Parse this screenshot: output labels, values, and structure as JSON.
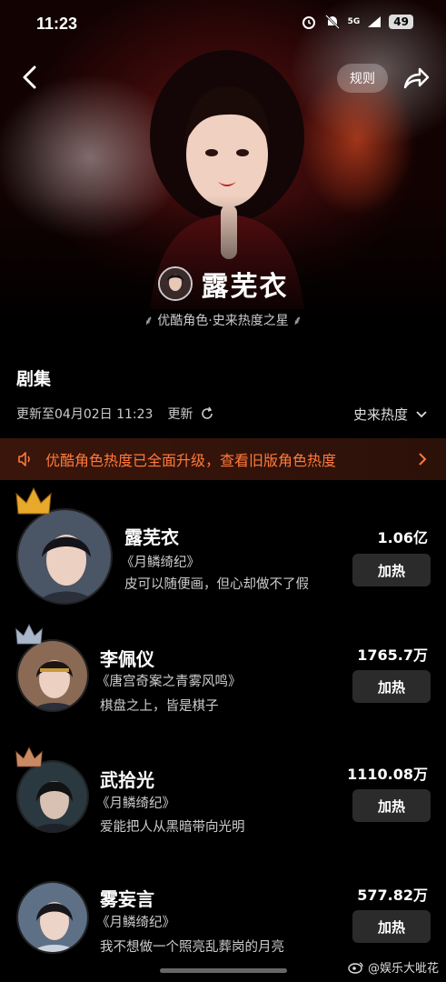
{
  "status": {
    "time": "11:23",
    "network": "5G",
    "battery": "49"
  },
  "header": {
    "rule_label": "规则"
  },
  "character": {
    "name": "露芜衣",
    "subtitle": "优酷角色·史来热度之星"
  },
  "section": {
    "title": "剧集",
    "updated": "更新至04月02日 11:23",
    "refresh_label": "更新",
    "sort_label": "史来热度"
  },
  "notice": {
    "text": "优酷角色热度已全面升级，查看旧版角色热度"
  },
  "ranking": [
    {
      "name": "露芜衣",
      "drama": "《月鳞绮纪》",
      "quote": "皮可以随便画，但心却做不了假",
      "score": "1.06亿",
      "button": "加热",
      "crown_color": "#e8a92a"
    },
    {
      "name": "李佩仪",
      "drama": "《唐宫奇案之青雾风鸣》",
      "quote": "棋盘之上，皆是棋子",
      "score": "1765.7万",
      "button": "加热",
      "crown_color": "#a9b6c9"
    },
    {
      "name": "武拾光",
      "drama": "《月鳞绮纪》",
      "quote": "爱能把人从黑暗带向光明",
      "score": "1110.08万",
      "button": "加热",
      "crown_color": "#c98a63"
    },
    {
      "name": "雾妄言",
      "drama": "《月鳞绮纪》",
      "quote": "我不想做一个照亮乱葬岗的月亮",
      "score": "577.82万",
      "button": "加热"
    }
  ],
  "watermark": "@娱乐大呲花",
  "colors": {
    "accent": "#ff7a3a",
    "background": "#000000",
    "button": "#2b2b2b"
  }
}
